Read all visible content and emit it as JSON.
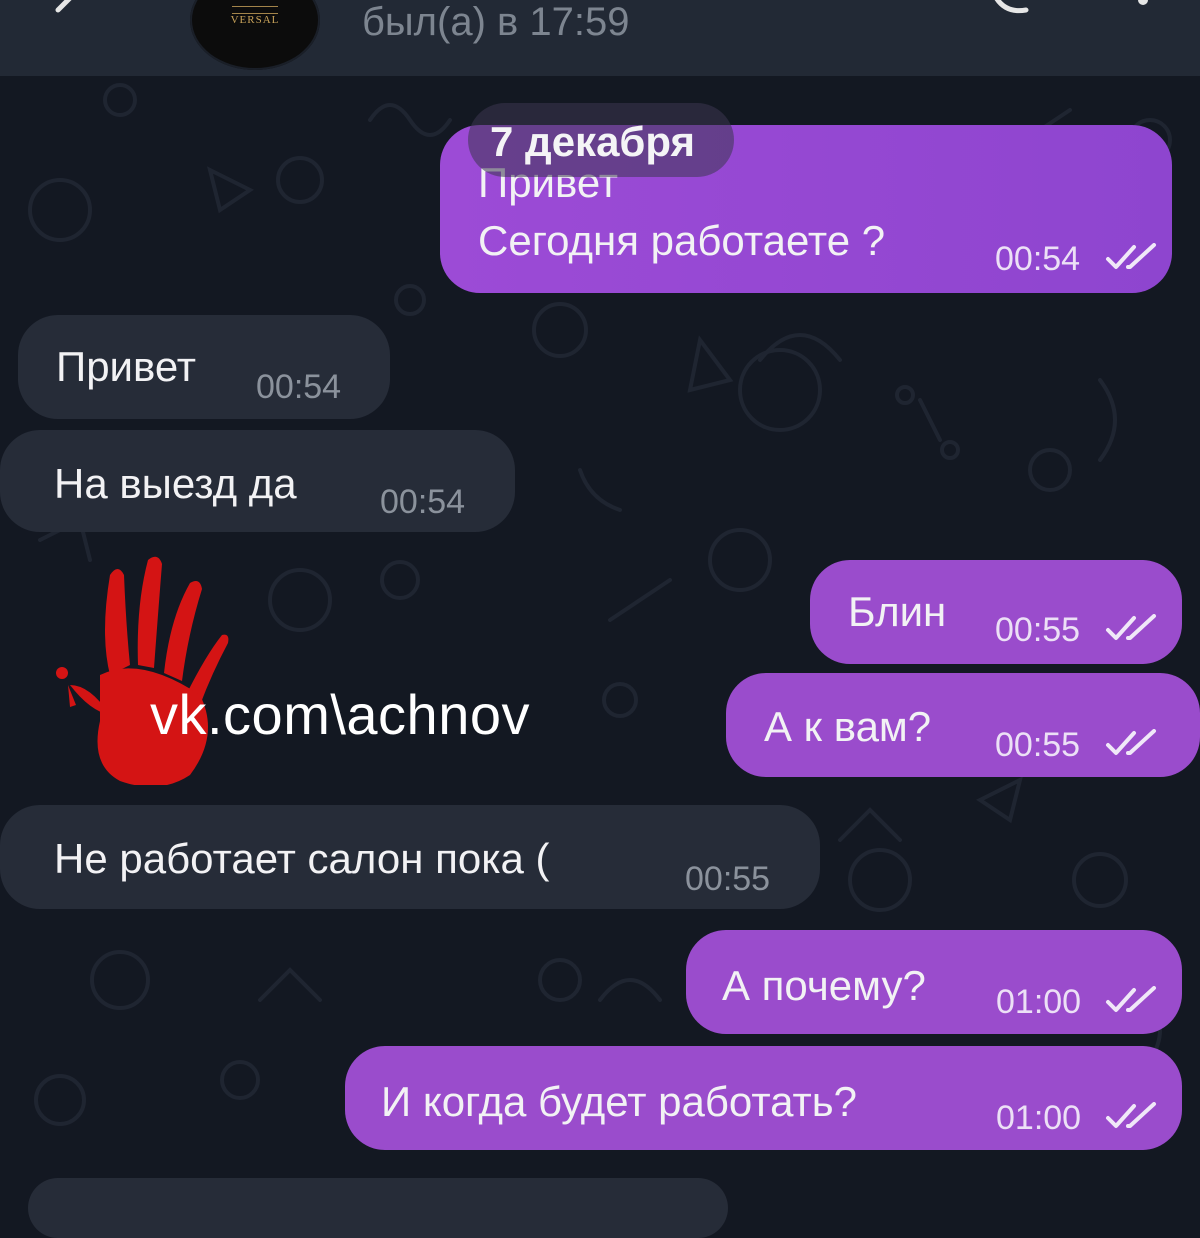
{
  "header": {
    "status": "был(а) в 17:59",
    "avatar_text": "VERSAL"
  },
  "date_divider": "7 декабря",
  "messages": [
    {
      "direction": "out",
      "lines": [
        "Привет",
        "Сегодня работаете ?"
      ],
      "time": "00:54",
      "read": true
    },
    {
      "direction": "in",
      "text": "Привет",
      "time": "00:54"
    },
    {
      "direction": "in",
      "text": "На выезд да",
      "time": "00:54"
    },
    {
      "direction": "out",
      "text": "Блин",
      "time": "00:55",
      "read": true
    },
    {
      "direction": "out",
      "text": "А к вам?",
      "time": "00:55",
      "read": true
    },
    {
      "direction": "in",
      "text": "Не работает салон пока (",
      "time": "00:55"
    },
    {
      "direction": "out",
      "text": "А почему?",
      "time": "01:00",
      "read": true
    },
    {
      "direction": "out",
      "text": "И когда будет работать?",
      "time": "01:00",
      "read": true
    }
  ],
  "watermark": "vk.com\\achnov",
  "icons": {
    "back": "back-arrow-icon",
    "call": "phone-icon",
    "menu": "more-icon",
    "read_receipt": "double-check-icon",
    "watermark_logo": "red-handprint-icon"
  },
  "colors": {
    "background": "#131822",
    "header": "#222935",
    "outgoing_bubble": "#9a4ccc",
    "incoming_bubble": "#262c38",
    "watermark_hand": "#d41414"
  }
}
